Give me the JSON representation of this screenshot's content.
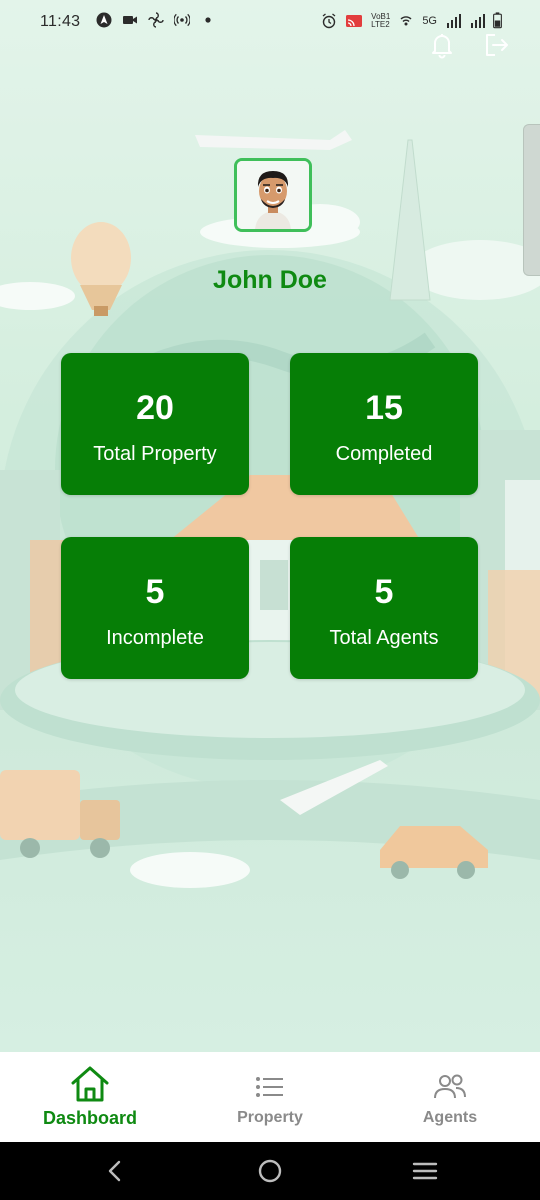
{
  "status_bar": {
    "time": "11:43",
    "left_icons": [
      "navigation-icon",
      "video-icon",
      "fan-icon",
      "hotspot-icon",
      "dot-icon"
    ],
    "right_icons": [
      "alarm-icon",
      "cast-icon",
      "volte-icon",
      "wifi-calling-icon",
      "signal-5g-icon",
      "signal-icon",
      "battery-icon"
    ],
    "volte_text": "VoB1\nLTE2",
    "network": "5G"
  },
  "header": {
    "icons": [
      "bell-icon",
      "logout-icon"
    ]
  },
  "profile": {
    "name": "John Doe"
  },
  "stats": [
    {
      "value": "20",
      "label": "Total Property"
    },
    {
      "value": "15",
      "label": "Completed"
    },
    {
      "value": "5",
      "label": "Incomplete"
    },
    {
      "value": "5",
      "label": "Total Agents"
    }
  ],
  "bottom_nav": {
    "items": [
      {
        "label": "Dashboard",
        "icon": "home-icon",
        "active": true
      },
      {
        "label": "Property",
        "icon": "list-icon",
        "active": false
      },
      {
        "label": "Agents",
        "icon": "users-icon",
        "active": false
      }
    ]
  },
  "colors": {
    "accent": "#067e06",
    "name_green": "#0f8a12",
    "inactive": "#8a8a8a"
  }
}
